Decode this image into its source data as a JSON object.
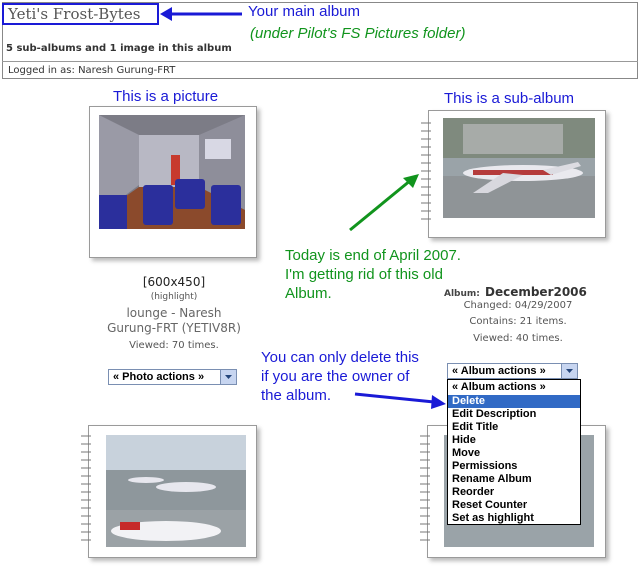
{
  "header": {
    "album_title": "Yeti's Frost-Bytes",
    "album_count": "5 sub-albums and 1 image in this album",
    "logged_in": "Logged in as: Naresh Gurung-FRT"
  },
  "annotations": {
    "main_album": "Your main album",
    "under_folder": "(under Pilot's FS Pictures folder)",
    "picture": "This is a picture",
    "sub_album": "This is a sub-album",
    "today_lines": [
      "Today is end of April 2007.",
      "I'm getting rid of this old",
      "Album."
    ],
    "delete_lines": [
      "You can only delete this",
      "if you are the owner of",
      "the album."
    ]
  },
  "picture_item": {
    "dimensions": "[600x450]",
    "highlight": "(highlight)",
    "title_lines": [
      "lounge - Naresh",
      "Gurung-FRT (YETIV8R)"
    ],
    "viewed": "Viewed: 70 times.",
    "actions_label": "« Photo actions »"
  },
  "subalbum_item": {
    "album_label": "Album:",
    "album_name": "December2006",
    "changed": "Changed: 04/29/2007",
    "contains": "Contains: 21 items.",
    "viewed": "Viewed: 40 times.",
    "actions_label": "« Album actions »",
    "menu_options": [
      "« Album actions »",
      "Delete",
      "Edit Description",
      "Edit Title",
      "Hide",
      "Move",
      "Permissions",
      "Rename Album",
      "Reorder",
      "Reset Counter",
      "Set as highlight"
    ],
    "selected_option": "Delete"
  },
  "colors": {
    "annotation_blue": "#1a1ad6",
    "annotation_green": "#11941d",
    "selected_option_bg": "#316ac5"
  }
}
